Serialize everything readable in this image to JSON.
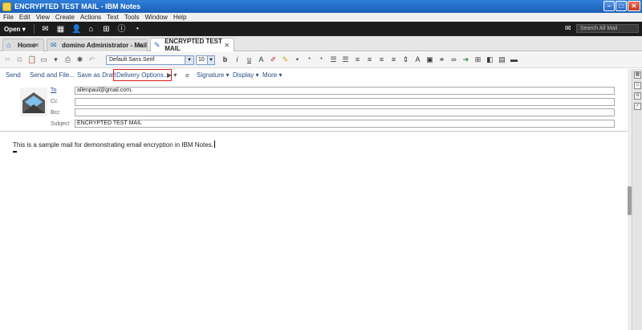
{
  "window": {
    "title": "ENCRYPTED TEST MAIL - IBM Notes"
  },
  "menu": [
    "File",
    "Edit",
    "View",
    "Create",
    "Actions",
    "Text",
    "Tools",
    "Window",
    "Help"
  ],
  "toolbar": {
    "open_label": "Open",
    "open_arrow": "▾",
    "search_placeholder": "Search All Mail"
  },
  "tabs": [
    {
      "label": "Home",
      "icon": "home-icon"
    },
    {
      "label": "domino Administrator - Mail",
      "icon": "mail-icon"
    },
    {
      "label": "ENCRYPTED TEST MAIL",
      "icon": "edit-document-icon"
    }
  ],
  "format": {
    "font": "Default Sans Serif",
    "size": "10"
  },
  "actions": [
    "Send",
    "Send and File...",
    "Save as Draft",
    "Delivery Options...",
    "Signature",
    "Display",
    "More"
  ],
  "highlighted_action": "Delivery Options...",
  "header": {
    "to_label": "To",
    "cc_label": "Cc",
    "bcc_label": "Bcc",
    "subject_label": "Subject",
    "to": "allenpaul@gmail.com,",
    "cc": "",
    "bcc": "",
    "subject": "ENCRYPTED TEST MAIL"
  },
  "body": {
    "text": "This is a sample mail for demonstrating email encryption in IBM Notes."
  },
  "colors": {
    "titlebar": "#1b5fb4",
    "dark_toolbar": "#1c1c1c",
    "highlight_border": "#e02020",
    "link": "#2a4f85"
  }
}
